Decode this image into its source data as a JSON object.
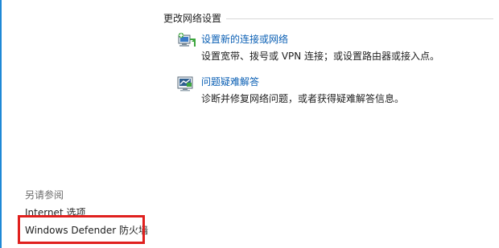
{
  "network_settings": {
    "header": "更改网络设置",
    "tasks": [
      {
        "icon": "network-setup-icon",
        "link": "设置新的连接或网络",
        "description": "设置宽带、拨号或 VPN 连接；或设置路由器或接入点。"
      },
      {
        "icon": "troubleshoot-icon",
        "link": "问题疑难解答",
        "description": "诊断并修复网络问题，或者获得疑难解答信息。"
      }
    ]
  },
  "see_also": {
    "title": "另请参阅",
    "links": [
      "Internet 选项",
      "Windows Defender 防火墙"
    ]
  },
  "colors": {
    "link": "#0a5fb4",
    "text": "#1e1e1e",
    "muted": "#6d6d6d",
    "highlight": "#e0201e",
    "accent_edge": "#1e88d6"
  }
}
